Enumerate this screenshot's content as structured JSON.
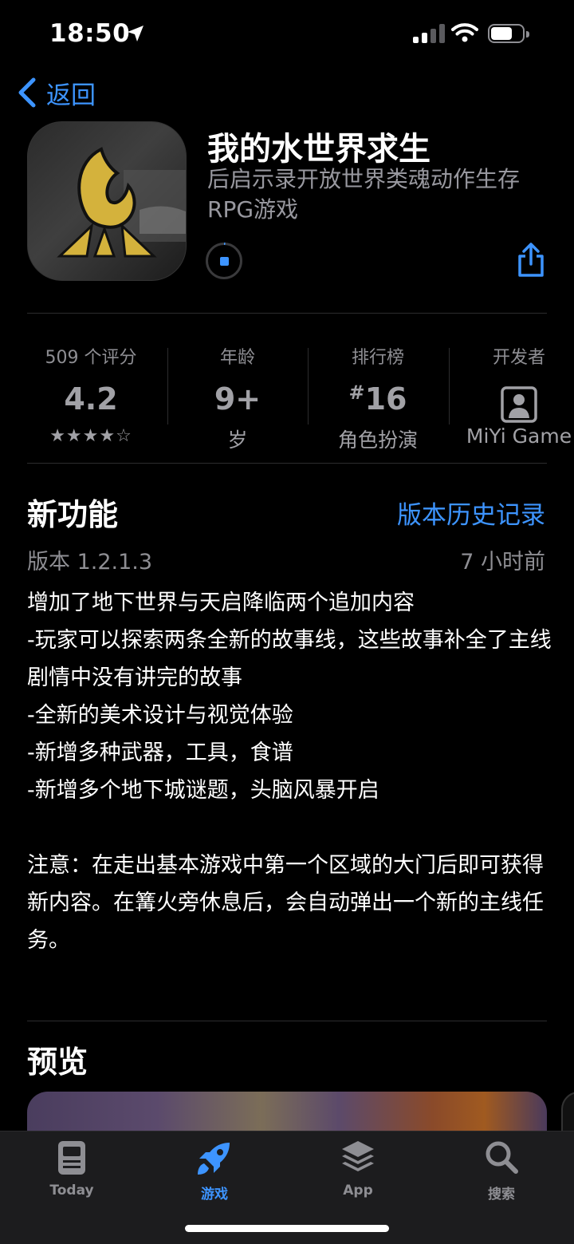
{
  "status": {
    "time": "18:50"
  },
  "nav": {
    "back_label": "返回"
  },
  "app": {
    "title": "我的水世界求生",
    "subtitle": "后启示录开放世界类魂动作生存RPG游戏"
  },
  "info": {
    "ratings": {
      "label": "509 个评分",
      "value": "4.2",
      "stars": "★★★★☆",
      "rating_fraction": 0.84
    },
    "age": {
      "label": "年龄",
      "value": "9+",
      "sub": "岁"
    },
    "chart": {
      "label": "排行榜",
      "hash": "#",
      "value": "16",
      "sub": "角色扮演"
    },
    "developer": {
      "label": "开发者",
      "sub": "MiYi Game"
    }
  },
  "whats_new": {
    "title": "新功能",
    "history_link": "版本历史记录",
    "version": "版本 1.2.1.3",
    "time_ago": "7 小时前",
    "notes": "增加了地下世界与天启降临两个追加内容\n-玩家可以探索两条全新的故事线，这些故事补全了主线剧情中没有讲完的故事\n-全新的美术设计与视觉体验\n-新增多种武器，工具，食谱\n-新增多个地下城谜题，头脑风暴开启\n\n注意：在走出基本游戏中第一个区域的大门后即可获得新内容。在篝火旁休息后，会自动弹出一个新的主线任务。"
  },
  "preview": {
    "title": "预览"
  },
  "tabs": [
    {
      "label": "Today",
      "icon": "today-icon"
    },
    {
      "label": "游戏",
      "icon": "rocket-icon"
    },
    {
      "label": "App",
      "icon": "app-stack-icon"
    },
    {
      "label": "搜索",
      "icon": "search-icon"
    }
  ],
  "colors": {
    "accent": "#3d94ff",
    "background": "#000000",
    "secondary_text": "#8e8e93"
  }
}
